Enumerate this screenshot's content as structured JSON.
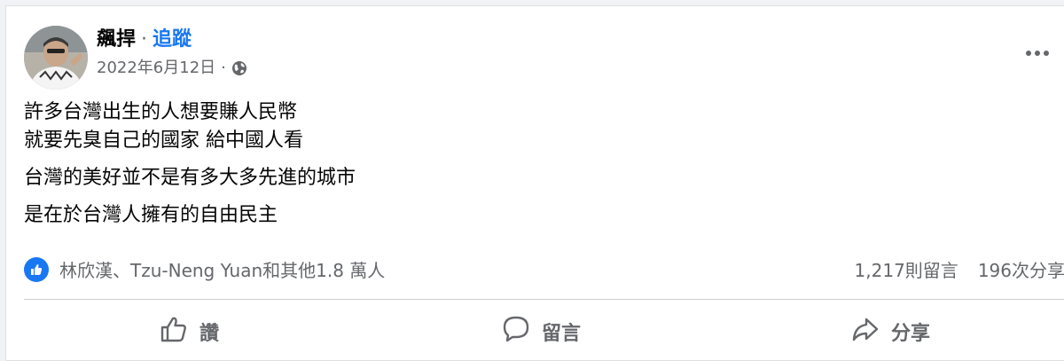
{
  "post": {
    "author": "飆捍",
    "separator": "·",
    "follow_label": "追蹤",
    "date": "2022年6月12日",
    "meta_separator": "·",
    "privacy_icon": "globe-icon",
    "more_icon": "more-horizontal-icon",
    "body_lines": [
      "許多台灣出生的人想要賺人民幣",
      "就要先臭自己的國家 給中國人看",
      "台灣的美好並不是有多大多先進的城市",
      "是在於台灣人擁有的自由民主"
    ]
  },
  "reactions": {
    "icon": "like-icon",
    "names": "林欣漢、Tzu-Neng Yuan和其他1.8 萬人",
    "comments_count": "1,217則留言",
    "shares_count": "196次分享"
  },
  "actions": {
    "like_label": "讚",
    "comment_label": "留言",
    "share_label": "分享"
  },
  "colors": {
    "accent": "#1877f2",
    "secondary_text": "#65676b",
    "primary_text": "#050505",
    "divider": "#ced0d4"
  }
}
